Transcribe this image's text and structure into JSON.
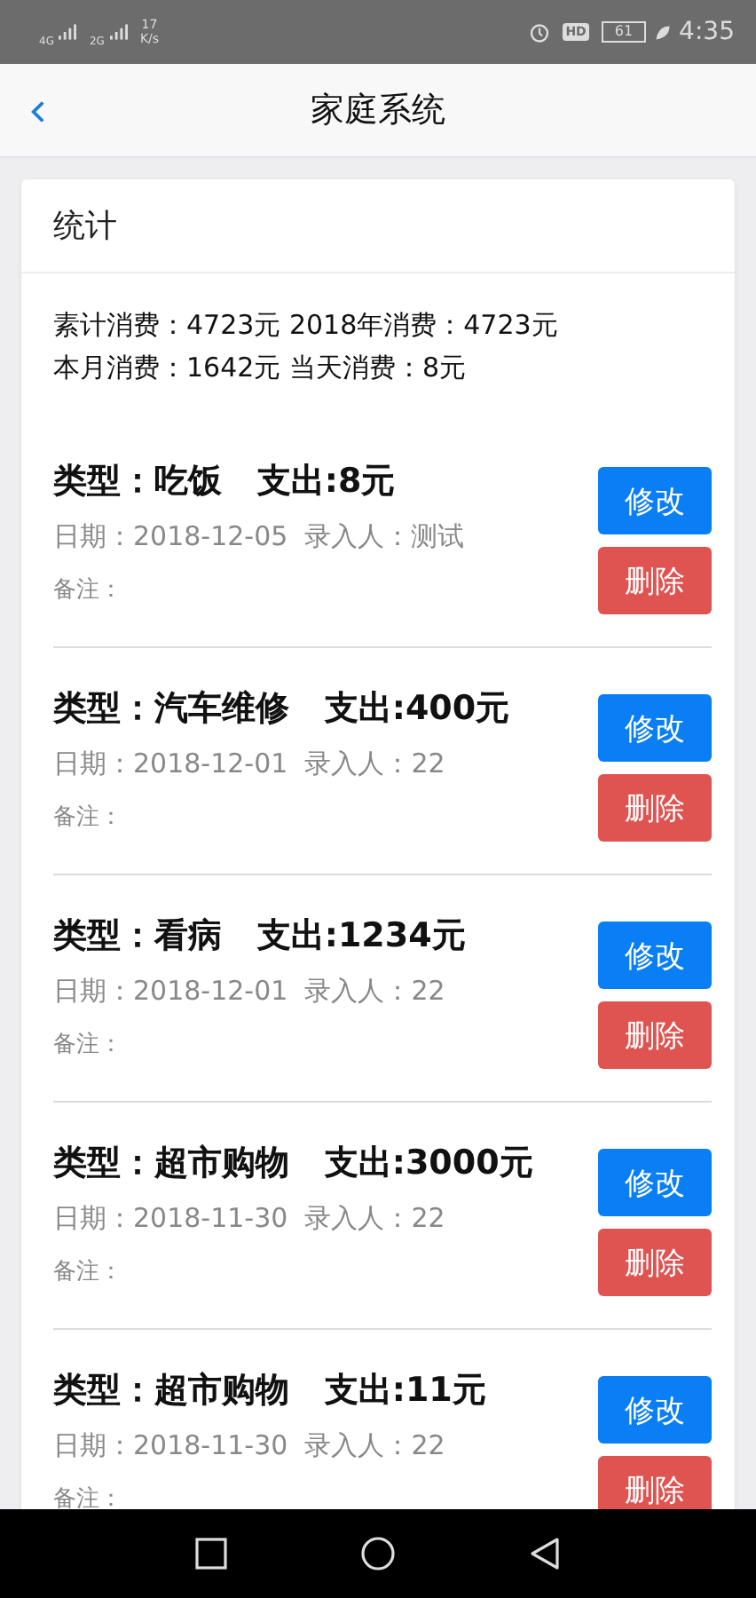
{
  "status_bar": {
    "signal_1": "4G",
    "signal_2": "2G",
    "speed_value": "17",
    "speed_unit": "K/s",
    "hd_badge": "HD",
    "battery": "61",
    "time": "4:35"
  },
  "header": {
    "title": "家庭系统"
  },
  "stats": {
    "title": "统计",
    "lines": [
      "素计消费：4723元 2018年消费：4723元",
      "本月消费：1642元 当天消费：8元"
    ]
  },
  "records": [
    {
      "title": "类型：吃饭   支出:8元",
      "meta": "日期：2018-12-05  录入人：测试",
      "note": "备注：",
      "edit": "修改",
      "delete": "删除"
    },
    {
      "title": "类型：汽车维修   支出:400元",
      "meta": "日期：2018-12-01  录入人：22",
      "note": "备注：",
      "edit": "修改",
      "delete": "删除"
    },
    {
      "title": "类型：看病   支出:1234元",
      "meta": "日期：2018-12-01  录入人：22",
      "note": "备注：",
      "edit": "修改",
      "delete": "删除"
    },
    {
      "title": "类型：超市购物   支出:3000元",
      "meta": "日期：2018-11-30  录入人：22",
      "note": "备注：",
      "edit": "修改",
      "delete": "删除"
    },
    {
      "title": "类型：超市购物   支出:11元",
      "meta": "日期：2018-11-30  录入人：22",
      "note": "备注：",
      "edit": "修改",
      "delete": "删除"
    }
  ]
}
